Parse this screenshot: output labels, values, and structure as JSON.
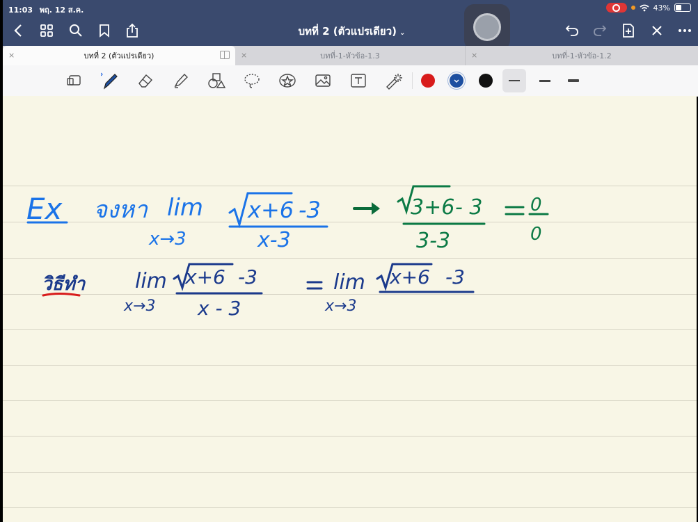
{
  "status": {
    "time": "11:03",
    "date": "พฤ. 12 ส.ค.",
    "battery": "43%"
  },
  "nav": {
    "title": "บทที่ 2 (ตัวแปรเดียว)"
  },
  "tabs": [
    {
      "label": "บทที่ 2 (ตัวแปรเดียว)",
      "active": true
    },
    {
      "label": "บทที่-1-หัวข้อ-1.3",
      "active": false
    },
    {
      "label": "บทที่-1-หัวข้อ-1.2",
      "active": false
    }
  ],
  "toolbar": {
    "tools": [
      "lasso-crop-icon",
      "pen-icon",
      "eraser-icon",
      "highlighter-icon",
      "shapes-icon",
      "lasso-icon",
      "sticker-icon",
      "image-icon",
      "text-icon",
      "laser-pointer-icon"
    ],
    "colors": [
      "#d81b1b",
      "#1d4fa0",
      "#111111"
    ],
    "selected_color": "#1d4fa0"
  },
  "canvas": {
    "background": "#f8f6e6",
    "line1": {
      "ex": "Ex",
      "prompt": "จงหา",
      "lim": "lim",
      "sub": "x→3",
      "num": "x+6",
      "minus3": "-3",
      "den": "x-3",
      "sub_num": "3+6",
      "sub_minus3": "- 3",
      "sub_den": "3-3",
      "eq": "=",
      "zero_num": "0",
      "zero_den": "0"
    },
    "line2": {
      "label": "วิธีทำ",
      "lim": "lim",
      "sub": "x→3",
      "num": "x+6",
      "minus3": "-3",
      "den": "x - 3",
      "eq": "=",
      "lim2": "lim",
      "sub2": "x→3",
      "num2": "x+6",
      "minus3b": "-3"
    }
  }
}
